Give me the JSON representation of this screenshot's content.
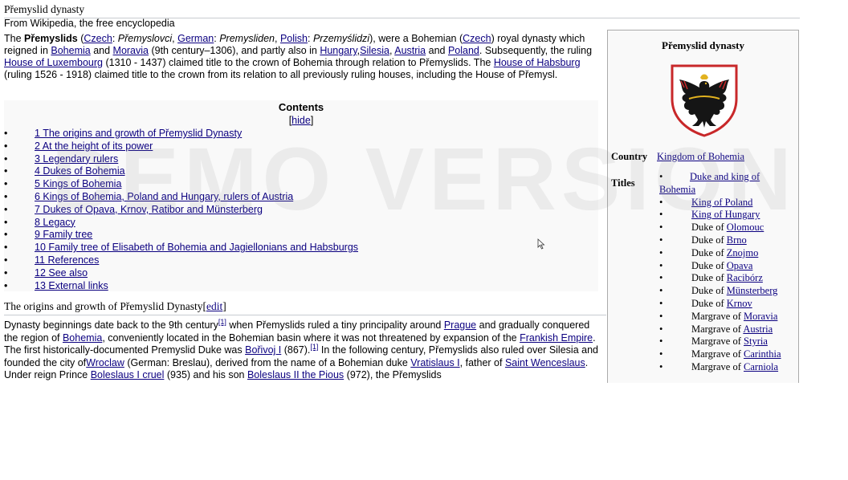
{
  "page": {
    "title": "Přemyslid dynasty",
    "tagline": "From Wikipedia, the free encyclopedia"
  },
  "intro": {
    "t1": "The ",
    "bold_name": "Přemyslids",
    "t2": " (",
    "czech_link": "Czech",
    "t3": ": ",
    "czech_name": "Přemyslovci",
    "t4": ", ",
    "german_link": "German",
    "t5": ": ",
    "german_name": "Premysliden",
    "t6": ", ",
    "polish_link": "Polish",
    "t7": ": ",
    "polish_name": "Przemyślidzi",
    "t8": "), were a Bohemian (",
    "czech_link2": "Czech",
    "t9": ") royal dynasty which reigned in ",
    "bohemia_link": "Bohemia",
    "t10": " and ",
    "moravia_link": "Moravia",
    "t11": " (9th century–1306), and partly also in ",
    "hungary_link": "Hungary",
    "t12": ",",
    "silesia_link": "Silesia",
    "t13": ", ",
    "austria_link": "Austria",
    "t14": " and ",
    "poland_link": "Poland",
    "t15": ". Subsequently, the ruling ",
    "luxembourg_link": "House of Luxembourg",
    "t16": " (1310 - 1437) claimed title to the crown of Bohemia through relation to Přemyslids. The ",
    "habsburg_link": "House of Habsburg",
    "t17": " (ruling 1526 - 1918) claimed title to the crown from its relation to all previously ruling houses, including the House of Přemysl."
  },
  "toc": {
    "title": "Contents",
    "hide_open": "[",
    "hide_label": "hide",
    "hide_close": "]",
    "bullet": "•",
    "items": [
      "1 The origins and growth of Přemyslid Dynasty",
      "2 At the height of its power",
      "3 Legendary rulers",
      "4 Dukes of Bohemia",
      "5 Kings of Bohemia",
      "6 Kings of Bohemia, Poland and Hungary, rulers of Austria",
      "7 Dukes of Opava, Krnov, Ratibor and Münsterberg",
      "8 Legacy",
      "9 Family tree",
      "10 Family tree of Elisabeth of Bohemia and Jagiellonians and Habsburgs",
      "11 References",
      "12 See also",
      "13 External links"
    ]
  },
  "section": {
    "heading": "The origins and growth of Přemyslid Dynasty",
    "edit_open": "[",
    "edit_label": "edit",
    "edit_close": "]",
    "s1": "Dynasty beginnings date back to the 9th century",
    "ref1": "[1]",
    "s2": " when Přemyslids ruled a tiny principality around ",
    "prague_link": "Prague",
    "s3": " and gradually conquered the region of ",
    "bohemia_link": "Bohemia",
    "s4": ", conveniently located in the Bohemian basin where it was not threatened by expansion of the ",
    "frankish_link": "Frankish Empire",
    "s5": ". The first historically-documented Premyslid Duke was ",
    "borivoj_link": "Bořivoj I",
    "s6": " (867).",
    "ref2": "[1]",
    "s7": " In the following century, Přemyslids also ruled over Silesia and founded the city of",
    "wroclaw_link": "Wroclaw",
    "s8": " (German: Breslau), derived from the name of a Bohemian duke ",
    "vratislaus_link": "Vratislaus I",
    "s9": ", father of ",
    "wenceslaus_link": "Saint Wenceslaus",
    "s10": ". Under reign Prince ",
    "boleslaus1_link": "Boleslaus I cruel",
    "s11": " (935) and his son ",
    "boleslaus2_link": "Boleslaus II the Pious",
    "s12": " (972), the Přemyslids"
  },
  "infobox": {
    "title": "Přemyslid dynasty",
    "country_label": "Country",
    "country_value": "Kingdom of Bohemia",
    "titles_label": "Titles",
    "bullet": "•",
    "titles": [
      {
        "pre": "",
        "link": "Duke and king of Bohemia"
      },
      {
        "pre": "",
        "link": "King of Poland"
      },
      {
        "pre": "",
        "link": "King of Hungary"
      },
      {
        "pre": "Duke of ",
        "link": "Olomouc"
      },
      {
        "pre": "Duke of ",
        "link": "Brno"
      },
      {
        "pre": "Duke of ",
        "link": "Znojmo"
      },
      {
        "pre": "Duke of ",
        "link": "Opava"
      },
      {
        "pre": "Duke of ",
        "link": "Racibórz"
      },
      {
        "pre": "Duke of ",
        "link": "Münsterberg"
      },
      {
        "pre": "Duke of ",
        "link": "Krnov"
      },
      {
        "pre": "Margrave of ",
        "link": "Moravia"
      },
      {
        "pre": "Margrave of ",
        "link": "Austria"
      },
      {
        "pre": "Margrave of ",
        "link": "Styria"
      },
      {
        "pre": "Margrave of ",
        "link": "Carinthia"
      },
      {
        "pre": "Margrave of ",
        "link": "Carniola"
      }
    ]
  },
  "watermark": "DEMO VERSION",
  "colors": {
    "link": "#0b0080",
    "infobox_bg": "#f9f9f9",
    "rule": "#c8ccd1"
  }
}
